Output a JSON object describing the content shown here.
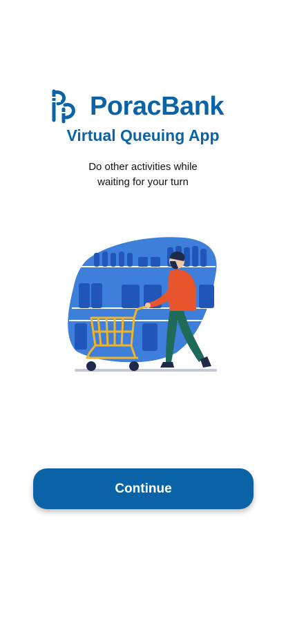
{
  "brand": {
    "logo_icon": "porac-bank-logo-icon",
    "name": "PoracBank",
    "color": "#0a63a6"
  },
  "header": {
    "app_title": "Virtual Queuing App"
  },
  "intro": {
    "line1": "Do other activities while",
    "line2": "waiting for your turn"
  },
  "illustration": {
    "icon": "shopping-cart-person-illustration"
  },
  "actions": {
    "continue_label": "Continue"
  }
}
